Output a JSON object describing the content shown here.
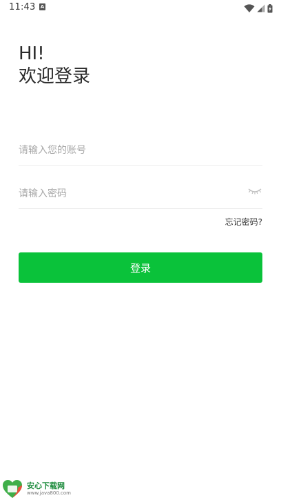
{
  "status_bar": {
    "time": "11:43",
    "notification_letter": "A"
  },
  "greeting": {
    "line1": "HI!",
    "line2": "欢迎登录"
  },
  "account_input": {
    "placeholder": "请输入您的账号",
    "value": ""
  },
  "password_input": {
    "placeholder": "请输入密码",
    "value": ""
  },
  "forgot_password": "忘记密码?",
  "login_button": "登录",
  "watermark": {
    "title": "安心下载网",
    "url": "www.java800.com"
  },
  "colors": {
    "accent": "#0ac23a",
    "divider": "#ececec",
    "placeholder": "#a8a8a8"
  },
  "icons": {
    "wifi": "wifi-icon",
    "signal": "signal-icon",
    "battery": "battery-icon",
    "password_visibility": "eye-closed-icon"
  }
}
